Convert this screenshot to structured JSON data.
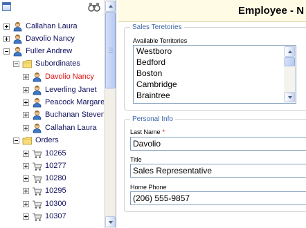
{
  "tree": {
    "nodes": [
      {
        "label": "Callahan Laura",
        "icon": "person-icon",
        "expander": "plus",
        "selected": false
      },
      {
        "label": "Davolio Nancy",
        "icon": "person-icon",
        "expander": "plus",
        "selected": false
      },
      {
        "label": "Fuller Andrew",
        "icon": "person-icon",
        "expander": "minus",
        "selected": false
      },
      {
        "label": "Subordinates",
        "icon": "folder-icon",
        "expander": "minus",
        "selected": false
      },
      {
        "label": "Davolio Nancy",
        "icon": "person-icon",
        "expander": "plus",
        "selected": true
      },
      {
        "label": "Leverling Janet",
        "icon": "person-icon",
        "expander": "plus",
        "selected": false
      },
      {
        "label": "Peacock Margaret",
        "icon": "person-icon",
        "expander": "plus",
        "selected": false
      },
      {
        "label": "Buchanan Steven",
        "icon": "person-icon",
        "expander": "plus",
        "selected": false
      },
      {
        "label": "Callahan Laura",
        "icon": "person-icon",
        "expander": "plus",
        "selected": false
      },
      {
        "label": "Orders",
        "icon": "folder-icon",
        "expander": "minus",
        "selected": false
      },
      {
        "label": "10265",
        "icon": "cart-icon",
        "expander": "plus",
        "selected": false
      },
      {
        "label": "10277",
        "icon": "cart-icon",
        "expander": "plus",
        "selected": false
      },
      {
        "label": "10280",
        "icon": "cart-icon",
        "expander": "plus",
        "selected": false
      },
      {
        "label": "10295",
        "icon": "cart-icon",
        "expander": "plus",
        "selected": false
      },
      {
        "label": "10300",
        "icon": "cart-icon",
        "expander": "plus",
        "selected": false
      },
      {
        "label": "10307",
        "icon": "cart-icon",
        "expander": "plus",
        "selected": false
      }
    ]
  },
  "form": {
    "title": "Employee - N",
    "territories": {
      "legend": "Sales Teretories",
      "label": "Available Territories",
      "items": [
        "Westboro",
        "Bedford",
        "Boston",
        "Cambridge",
        "Braintree"
      ]
    },
    "personal": {
      "legend": "Personal Info",
      "last_name_label": "Last Name",
      "required_marker": "*",
      "last_name_value": "Davolio",
      "title_label": "Title",
      "title_value": "Sales Representative",
      "home_phone_label": "Home Phone",
      "home_phone_value": "(206) 555-9857"
    }
  },
  "colors": {
    "accent": "#3b64a8",
    "selected_node": "#e01010",
    "header_bg": "#fffbe5"
  }
}
